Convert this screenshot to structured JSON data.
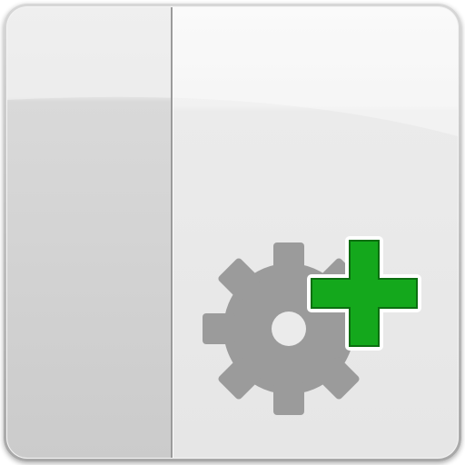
{
  "icon": {
    "name": "add-settings-icon",
    "parts": [
      "window-pane-icon",
      "gear-icon",
      "plus-icon"
    ]
  },
  "colors": {
    "frame_edge": "#8c8c8c",
    "frame_fill": "#f2f2f2",
    "left_pane_top": "#e4e4e4",
    "left_pane_bottom": "#cfcfcf",
    "right_pane_top": "#f6f6f6",
    "right_pane_bottom": "#e8e8e8",
    "divider": "#9a9a9a",
    "gear": "#9b9b9b",
    "plus_fill": "#14a81c",
    "plus_edge": "#0b6f10"
  }
}
